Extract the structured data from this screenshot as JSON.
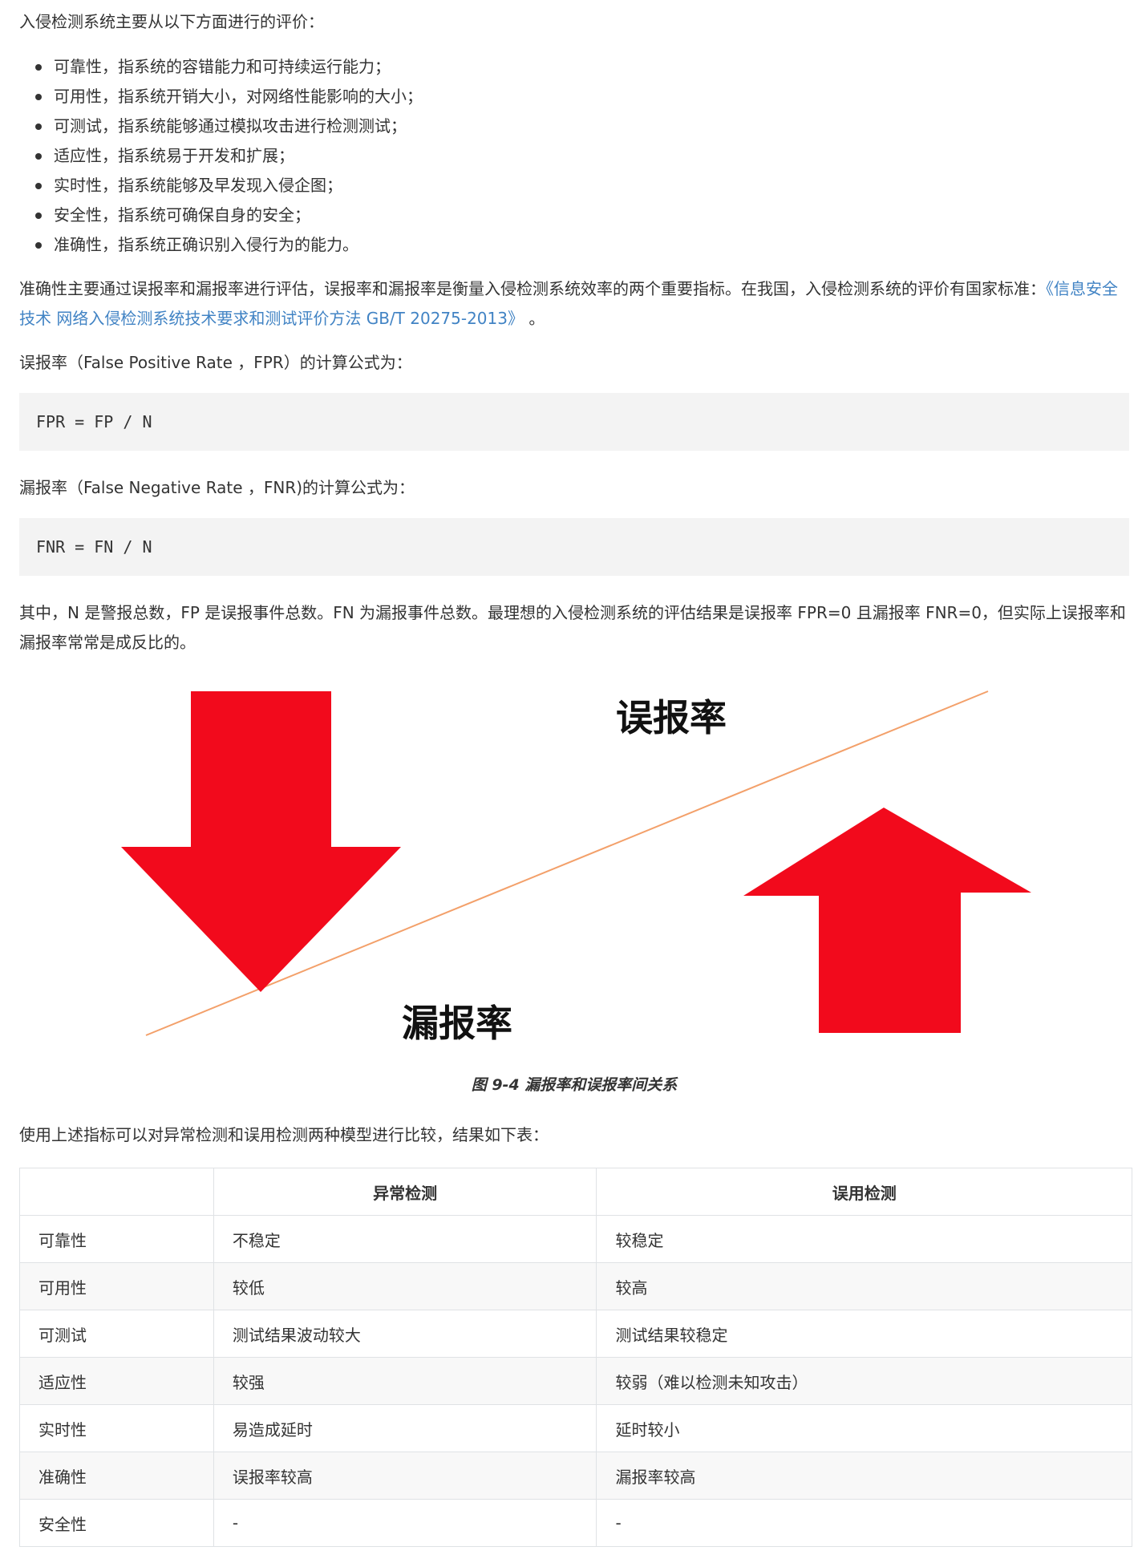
{
  "intro": "入侵检测系统主要从以下方面进行的评价：",
  "criteria": [
    "可靠性，指系统的容错能力和可持续运行能力；",
    "可用性，指系统开销大小，对网络性能影响的大小；",
    "可测试，指系统能够通过模拟攻击进行检测测试；",
    "适应性，指系统易于开发和扩展；",
    "实时性，指系统能够及早发现入侵企图；",
    "安全性，指系统可确保自身的安全；",
    "准确性，指系统正确识别入侵行为的能力。"
  ],
  "accuracy": {
    "text_before": "准确性主要通过误报率和漏报率进行评估，误报率和漏报率是衡量入侵检测系统效率的两个重要指标。在我国，入侵检测系统的评价有国家标准：",
    "link": "《信息安全技术 网络入侵检测系统技术要求和测试评价方法 GB/T 20275-2013》",
    "text_after": " 。"
  },
  "fpr": {
    "intro": "误报率（False Positive Rate ，FPR）的计算公式为：",
    "code": "FPR = FP / N"
  },
  "fnr": {
    "intro": "漏报率（False Negative Rate ，FNR)的计算公式为：",
    "code": "FNR = FN / N"
  },
  "relation": "其中，N 是警报总数，FP 是误报事件总数。FN 为漏报事件总数。最理想的入侵检测系统的评估结果是误报率 FPR=0 且漏报率 FNR=0，但实际上误报率和漏报率常常是成反比的。",
  "figure": {
    "label_fpr": "误报率",
    "label_fnr": "漏报率",
    "arrow_color": "#f20a1c",
    "line_color": "#f3a06a",
    "caption": "图 9-4 漏报率和误报率间关系"
  },
  "compare_intro": "使用上述指标可以对异常检测和误用检测两种模型进行比较，结果如下表：",
  "table": {
    "headers": [
      "",
      "异常检测",
      "误用检测"
    ],
    "rows": [
      [
        "可靠性",
        "不稳定",
        "较稳定"
      ],
      [
        "可用性",
        "较低",
        "较高"
      ],
      [
        "可测试",
        "测试结果波动较大",
        "测试结果较稳定"
      ],
      [
        "适应性",
        "较强",
        "较弱（难以检测未知攻击）"
      ],
      [
        "实时性",
        "易造成延时",
        "延时较小"
      ],
      [
        "准确性",
        "误报率较高",
        "漏报率较高"
      ],
      [
        "安全性",
        "-",
        "-"
      ]
    ]
  }
}
